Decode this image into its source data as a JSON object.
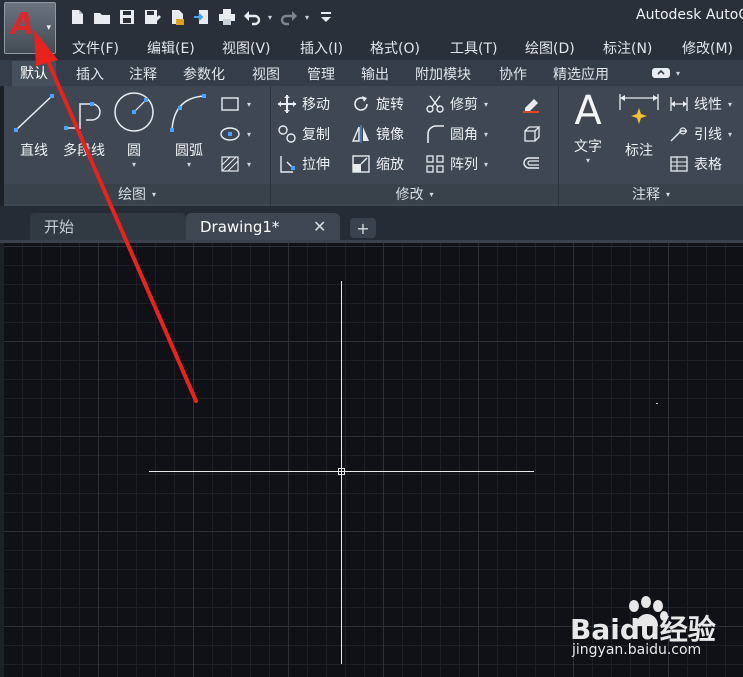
{
  "title_bar": {
    "app_button_caret": "▾",
    "app_title": "Autodesk AutoCAD",
    "quick_access_icons": [
      "new-file-icon",
      "open-folder-icon",
      "save-icon",
      "save-as-icon",
      "export-icon",
      "share-icon",
      "print-icon",
      "undo-icon",
      "redo-icon",
      "customize-icon"
    ],
    "caret": "▾"
  },
  "menu": {
    "items": [
      "文件(F)",
      "编辑(E)",
      "视图(V)",
      "插入(I)",
      "格式(O)",
      "工具(T)",
      "绘图(D)",
      "标注(N)",
      "修改(M)"
    ]
  },
  "ribbon_tabs": {
    "items": [
      "默认",
      "插入",
      "注释",
      "参数化",
      "视图",
      "管理",
      "输出",
      "附加模块",
      "协作",
      "精选应用"
    ],
    "active": "默认"
  },
  "ribbon": {
    "draw_panel": {
      "title": "绘图",
      "line": "直线",
      "polyline": "多段线",
      "circle": "圆",
      "arc": "圆弧"
    },
    "modify_panel": {
      "title": "修改",
      "move": "移动",
      "rotate": "旋转",
      "trim": "修剪",
      "copy": "复制",
      "mirror": "镜像",
      "fillet": "圆角",
      "stretch": "拉伸",
      "scale": "缩放",
      "array": "阵列"
    },
    "annotation_panel": {
      "title": "注释",
      "text": "文字",
      "dimension": "标注",
      "linear": "线性",
      "leader": "引线",
      "table": "表格"
    },
    "dropdown_caret": "▾"
  },
  "doc_tabs": {
    "start": "开始",
    "drawing": "Drawing1*",
    "close": "✕",
    "new_tab": "+"
  },
  "watermark": {
    "brand": "Baidu经验",
    "url": "jingyan.baidu.com"
  },
  "colors": {
    "annotation_arrow": "#e8231e",
    "app_logo": "#d62a2a"
  }
}
